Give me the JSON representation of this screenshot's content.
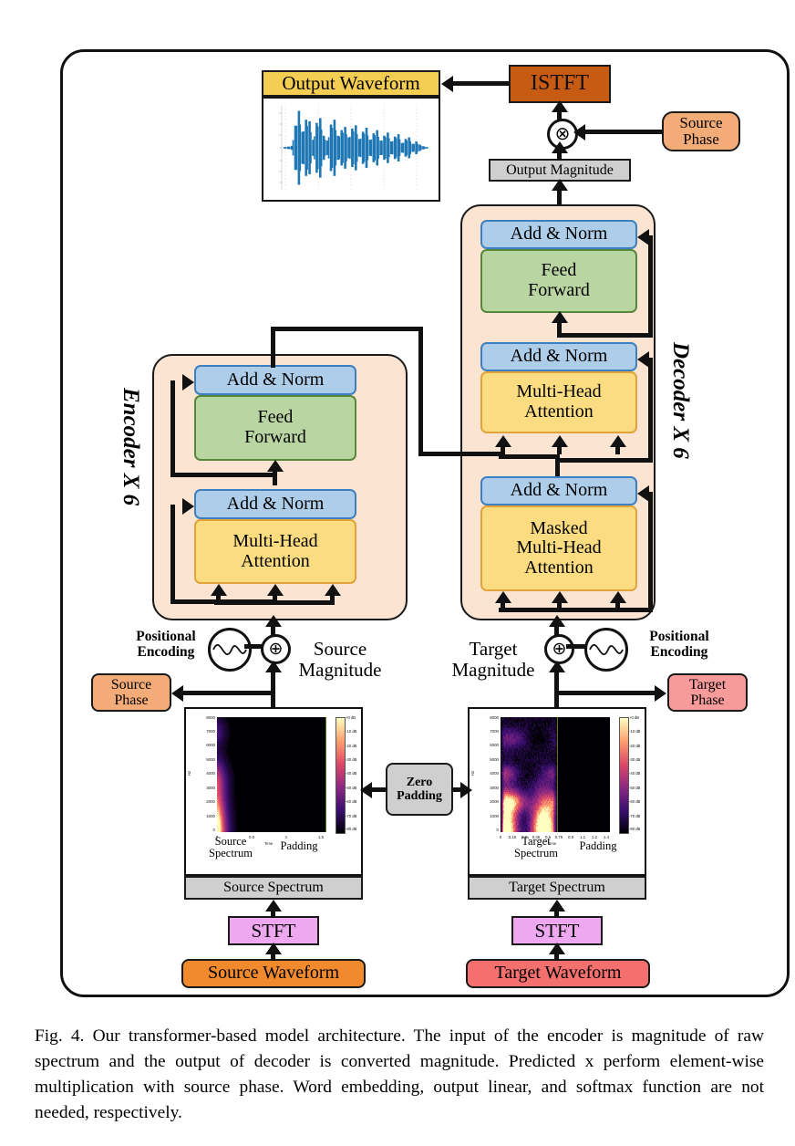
{
  "figure": {
    "label": "Fig. 4.",
    "caption": "Fig. 4.  Our transformer-based model architecture. The input of the encoder is magnitude of raw spectrum and the output of decoder is converted magnitude. Predicted x perform element-wise multiplication with source phase. Word embedding, output linear, and softmax function are not needed, respectively."
  },
  "colors": {
    "output_waveform_bar": "#F4CE52",
    "istft": "#C75B14",
    "source_phase": "#F3AC78",
    "target_phase": "#F79A9A",
    "magnitude_gray": "#CFCFCF",
    "panel_peach": "#FBE4D2",
    "add_norm_blue": "#AECDE9",
    "feed_forward_green": "#B9D6A2",
    "attention_yellow": "#FBDC80",
    "stft_pink": "#EDA8F0",
    "source_waveform_orange": "#F08A2C",
    "target_waveform_red": "#F4706E",
    "zero_padding_gray": "#CFCFCF",
    "waveform_trace_blue": "#1F77B4"
  },
  "top": {
    "output_waveform_label": "Output Waveform",
    "istft_label": "ISTFT",
    "source_phase_label": "Source\nPhase",
    "source_phase_line1": "Source",
    "source_phase_line2": "Phase",
    "multiply_symbol": "⊗",
    "output_magnitude_label": "Output Magnitude"
  },
  "encoder": {
    "side_label": "Encoder X 6",
    "add_norm_top": "Add & Norm",
    "feed_forward_line1": "Feed",
    "feed_forward_line2": "Forward",
    "add_norm_bottom": "Add & Norm",
    "attention_line1": "Multi-Head",
    "attention_line2": "Attention"
  },
  "decoder": {
    "side_label": "Decoder X 6",
    "add_norm_top": "Add & Norm",
    "feed_forward_line1": "Feed",
    "feed_forward_line2": "Forward",
    "add_norm_mid": "Add & Norm",
    "cross_attention_line1": "Multi-Head",
    "cross_attention_line2": "Attention",
    "add_norm_bottom": "Add & Norm",
    "masked_attention_line1": "Masked",
    "masked_attention_line2": "Multi-Head",
    "masked_attention_line3": "Attention"
  },
  "positional": {
    "left_line1": "Positional",
    "left_line2": "Encoding",
    "right_line1": "Positional",
    "right_line2": "Encoding",
    "plus_symbol": "⊕"
  },
  "magnitudes": {
    "source_line1": "Source",
    "source_line2": "Magnitude",
    "target_line1": "Target",
    "target_line2": "Magnitude"
  },
  "phases": {
    "source_line1": "Source",
    "source_line2": "Phase",
    "target_line1": "Target",
    "target_line2": "Phase"
  },
  "middle": {
    "zero_padding_line1": "Zero",
    "zero_padding_line2": "Padding"
  },
  "source_branch": {
    "spectrum_bar_label": "Source Spectrum",
    "stft_label": "STFT",
    "waveform_label": "Source Waveform",
    "spectrum_caption_line1": "Source",
    "spectrum_caption_line2": "Spectrum",
    "padding_caption": "Padding"
  },
  "target_branch": {
    "spectrum_bar_label": "Target Spectrum",
    "stft_label": "STFT",
    "waveform_label": "Target Waveform",
    "spectrum_caption_line1": "Target",
    "spectrum_caption_line2": "Spectrum",
    "padding_caption": "Padding"
  },
  "chart_data": [
    {
      "type": "line",
      "name": "output-waveform",
      "title": "Output Waveform",
      "xlabel": "",
      "ylabel": "",
      "series": [
        {
          "name": "amplitude",
          "color": "#1F77B4",
          "envelope": [
            0.02,
            0.03,
            0.05,
            0.55,
            0.92,
            0.4,
            0.7,
            0.66,
            0.2,
            0.62,
            0.74,
            0.3,
            0.18,
            0.58,
            0.7,
            0.3,
            0.44,
            0.52,
            0.26,
            0.48,
            0.56,
            0.22,
            0.4,
            0.5,
            0.2,
            0.36,
            0.44,
            0.18,
            0.3,
            0.38,
            0.16,
            0.28,
            0.34,
            0.12,
            0.22,
            0.26,
            0.1,
            0.16,
            0.08,
            0.04,
            0.02
          ]
        }
      ]
    },
    {
      "type": "heatmap",
      "name": "source-spectrum",
      "title": "Source Spectrum",
      "xlabel": "Time",
      "ylabel": "Hz",
      "yticks": [
        "0",
        "1000",
        "2000",
        "3000",
        "4000",
        "5000",
        "6000",
        "7000",
        "8000"
      ],
      "ylim": [
        0,
        8000
      ],
      "xticks": [
        "0",
        "0.5",
        "1",
        "1.5"
      ],
      "xlim": [
        0,
        1.55
      ],
      "colorbar_ticks": [
        "+0 dB",
        "-10 dB",
        "-20 dB",
        "-30 dB",
        "-40 dB",
        "-50 dB",
        "-60 dB",
        "-70 dB",
        "-80 dB"
      ],
      "colormap": "magma",
      "signal_end_time": 0.3,
      "padding_start_time": 0.3
    },
    {
      "type": "heatmap",
      "name": "target-spectrum",
      "title": "Target Spectrum",
      "xlabel": "Time",
      "ylabel": "Hz",
      "yticks": [
        "0",
        "1000",
        "2000",
        "3000",
        "4000",
        "5000",
        "6000",
        "7000",
        "8000"
      ],
      "ylim": [
        0,
        8000
      ],
      "xticks": [
        "0",
        "0.15",
        "0.3",
        "0.45",
        "0.6",
        "0.75",
        "0.9",
        "1.1",
        "1.2",
        "1.4"
      ],
      "xlim": [
        0,
        1.5
      ],
      "colorbar_ticks": [
        "+0 dB",
        "-10 dB",
        "-20 dB",
        "-30 dB",
        "-40 dB",
        "-50 dB",
        "-60 dB",
        "-70 dB",
        "-80 dB"
      ],
      "colormap": "magma",
      "signal_end_time": 0.78,
      "padding_start_time": 0.78
    }
  ]
}
